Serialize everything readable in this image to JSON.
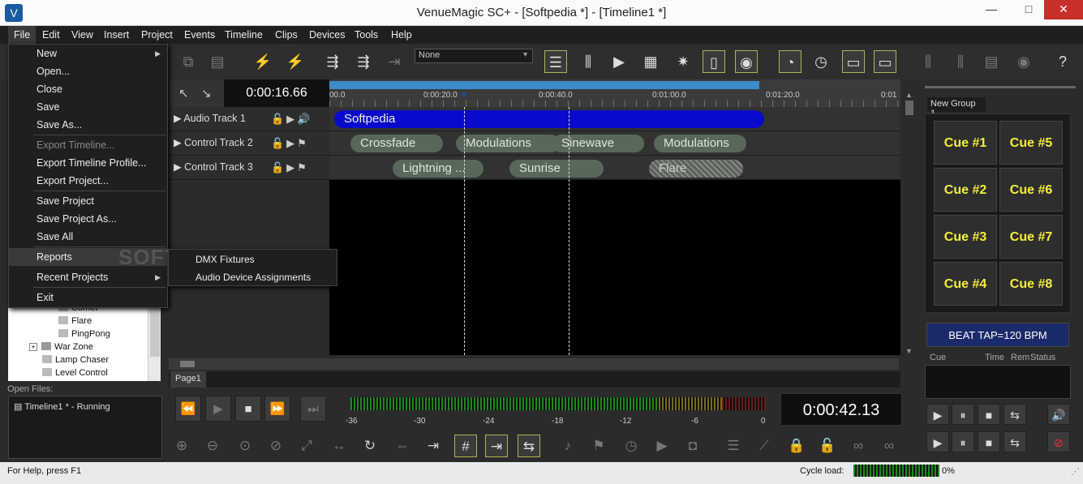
{
  "window": {
    "title": "VenueMagic SC+ - [Softpedia *] - [Timeline1 *]",
    "minimize": "—",
    "maximize": "□",
    "close": "✕"
  },
  "menubar": [
    "File",
    "Edit",
    "View",
    "Insert",
    "Project",
    "Events",
    "Timeline",
    "Clips",
    "Devices",
    "Tools",
    "Help"
  ],
  "toolbar": {
    "select_value": "None"
  },
  "file_menu": {
    "items": [
      "New",
      "Open...",
      "Close",
      "Save",
      "Save As...",
      "Export Timeline...",
      "Export Timeline Profile...",
      "Export Project...",
      "Save Project",
      "Save Project As...",
      "Save All",
      "Reports",
      "Recent Projects",
      "Exit"
    ],
    "reports_submenu": [
      "DMX Fixtures",
      "Audio Device Assignments"
    ]
  },
  "watermark": "SOFTPEDIA®",
  "tree": {
    "items": [
      "Comet",
      "Flare",
      "PingPong",
      "War Zone",
      "Lamp Chaser",
      "Level Control"
    ],
    "expander": "+"
  },
  "open_files": {
    "label": "Open Files:",
    "items": [
      "Timeline1 * - Running"
    ]
  },
  "timeline": {
    "current_time": "0:00:16.66",
    "ruler_labels": [
      "00.0",
      "0:00:20.0",
      "0:00:40.0",
      "0:01:00.0",
      "0:01:20.0",
      "0:01"
    ],
    "tracks": [
      {
        "name": "Audio Track 1",
        "clips": [
          "Softpedia"
        ]
      },
      {
        "name": "Control Track 2",
        "clips": [
          "Crossfade",
          "Modulations",
          "Sinewave",
          "Modulations"
        ]
      },
      {
        "name": "Control Track 3",
        "clips": [
          "Lightning ...",
          "Sunrise",
          "Flare"
        ]
      }
    ],
    "page_tab": "Page1"
  },
  "transport": {
    "time": "0:00:42.13",
    "meter_labels": [
      "-36",
      "-30",
      "-24",
      "-18",
      "-12",
      "-6",
      "0"
    ]
  },
  "cues": {
    "group_tab": "New Group 1",
    "buttons": [
      "Cue #1",
      "Cue #5",
      "Cue #2",
      "Cue #6",
      "Cue #3",
      "Cue #7",
      "Cue #4",
      "Cue #8"
    ],
    "beat_tap": "BEAT TAP=120 BPM",
    "list_headers": [
      "Cue",
      "Time",
      "Rem",
      "Status"
    ]
  },
  "statusbar": {
    "help": "For Help, press F1",
    "cycle_label": "Cycle load:",
    "cycle_value": "0%",
    "cycle_fraction": 0.0
  },
  "colors": {
    "accent_blue_clip": "#0a0acd",
    "clip_green": "#58675a",
    "cue_text": "#f5f038",
    "beat_tap_bg": "#1a2a6a"
  }
}
